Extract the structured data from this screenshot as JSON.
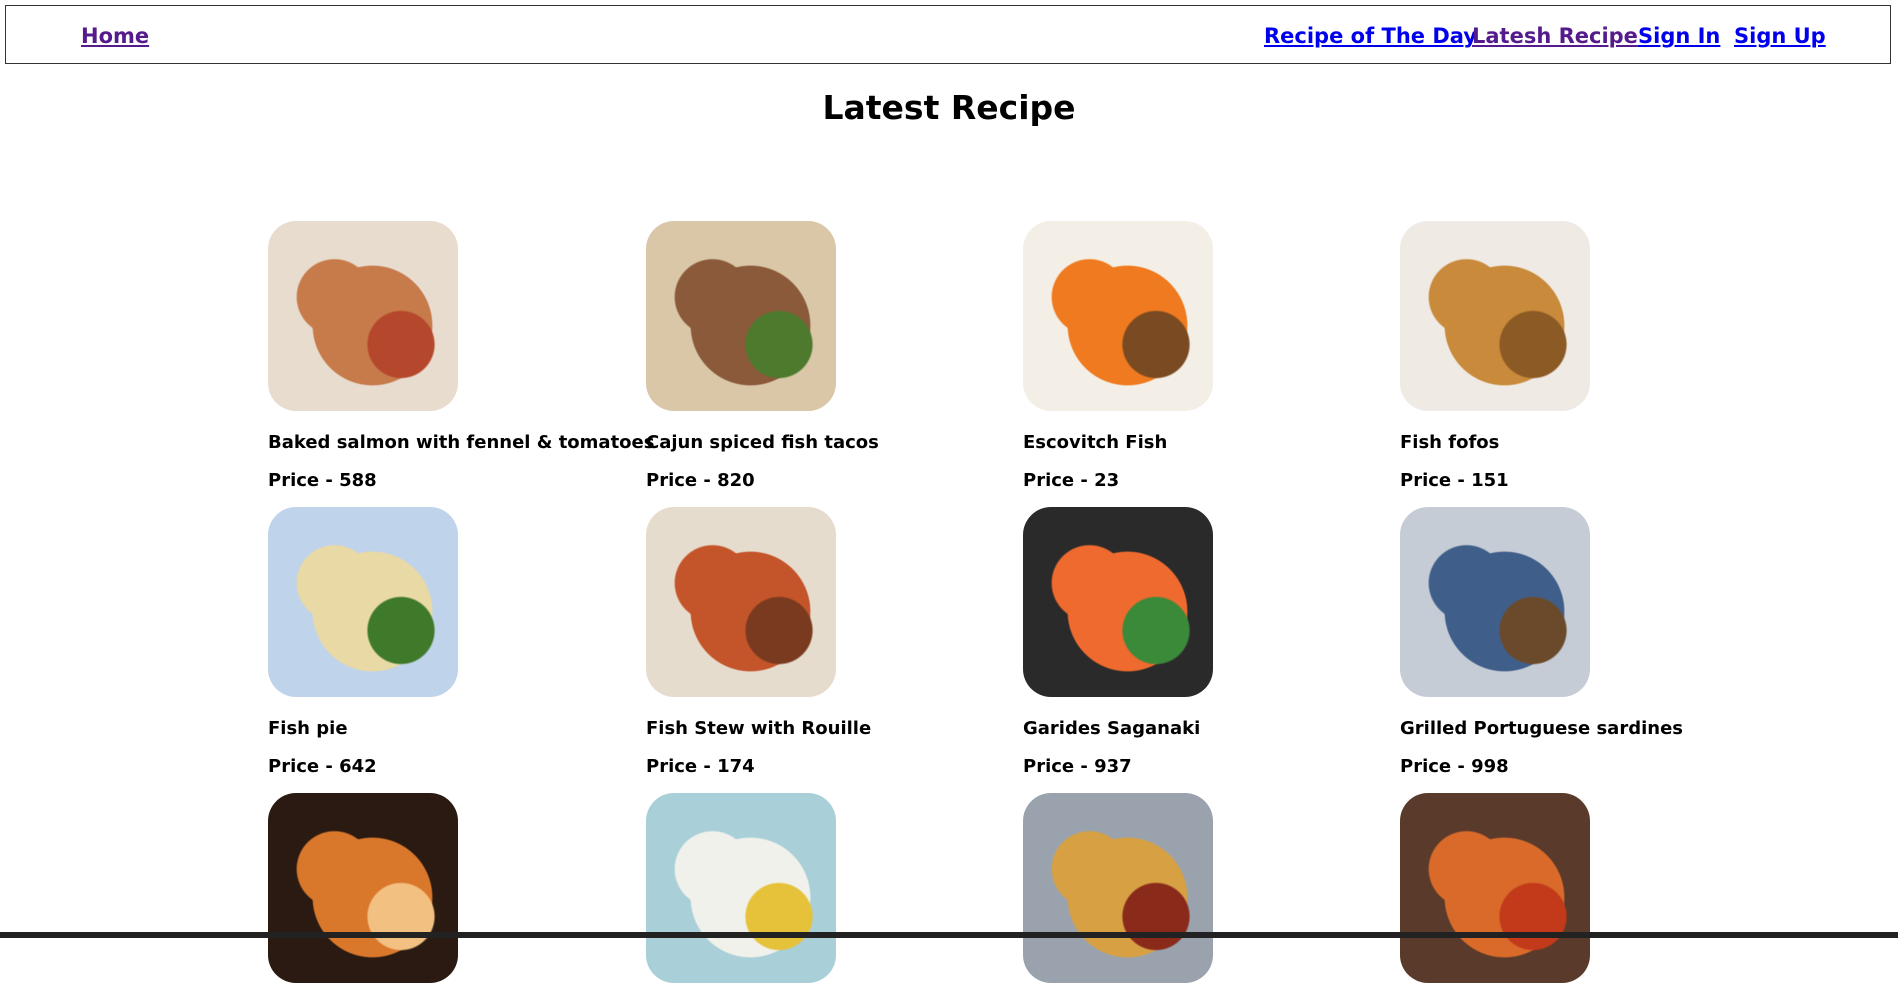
{
  "nav": {
    "home": "Home",
    "recipe_of_the_day": "Recipe of The Day",
    "latest_recipe": "Latesh Recipe",
    "sign_in": "Sign In",
    "sign_up": "Sign Up"
  },
  "page": {
    "title": "Latest Recipe"
  },
  "recipes": [
    {
      "name": "Baked salmon with fennel & tomatoes",
      "price": "Price - 588",
      "colors": [
        "#e8dccf",
        "#c77a4a",
        "#b5472c"
      ]
    },
    {
      "name": "Cajun spiced fish tacos",
      "price": "Price - 820",
      "colors": [
        "#d9c7a8",
        "#8a5a3a",
        "#4d7a2c"
      ]
    },
    {
      "name": "Escovitch Fish",
      "price": "Price - 23",
      "colors": [
        "#f4efe6",
        "#ef7a1f",
        "#7a4a22"
      ]
    },
    {
      "name": "Fish fofos",
      "price": "Price - 151",
      "colors": [
        "#efeae3",
        "#c98a3b",
        "#8c5a24"
      ]
    },
    {
      "name": "Fish pie",
      "price": "Price - 642",
      "colors": [
        "#bfd3ea",
        "#e9d9a4",
        "#3f7a2a"
      ]
    },
    {
      "name": "Fish Stew with Rouille",
      "price": "Price - 174",
      "colors": [
        "#e6dccd",
        "#c4552a",
        "#7a3a1f"
      ]
    },
    {
      "name": "Garides Saganaki",
      "price": "Price - 937",
      "colors": [
        "#2a2a2a",
        "#ef6a2e",
        "#3a8a3a"
      ]
    },
    {
      "name": "Grilled Portuguese sardines",
      "price": "Price - 998",
      "colors": [
        "#c5ccd6",
        "#3f5f8a",
        "#6a4a2a"
      ]
    },
    {
      "name": "",
      "price": "",
      "colors": [
        "#2a1a12",
        "#d9772a",
        "#f2c081"
      ]
    },
    {
      "name": "",
      "price": "",
      "colors": [
        "#a9cfd8",
        "#f1f1ec",
        "#e6c23a"
      ]
    },
    {
      "name": "",
      "price": "",
      "colors": [
        "#9aa3ad",
        "#d6a043",
        "#8a2a1a"
      ]
    },
    {
      "name": "",
      "price": "",
      "colors": [
        "#5a3a2a",
        "#d96a2a",
        "#c23a1a"
      ]
    }
  ]
}
